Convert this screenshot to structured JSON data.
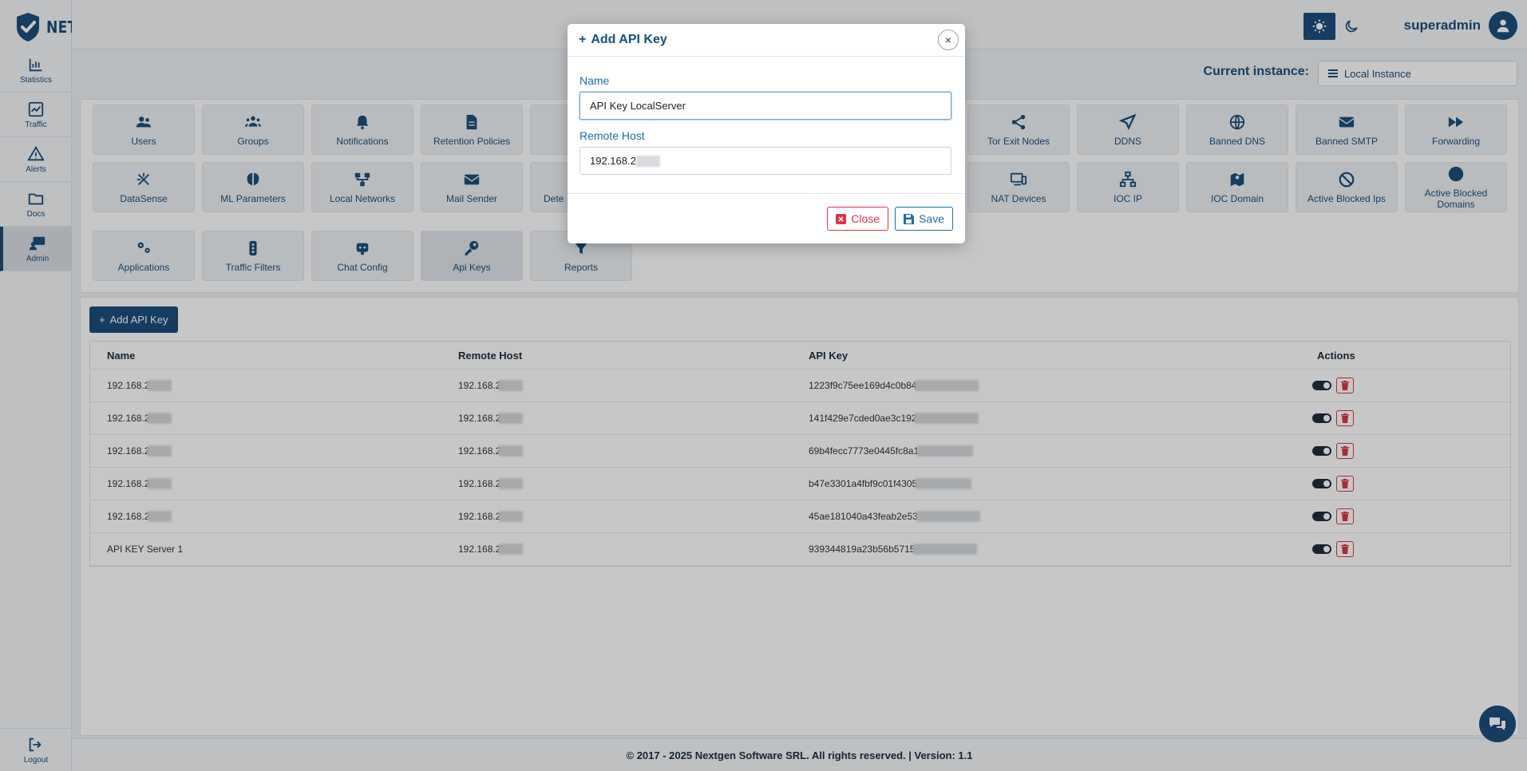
{
  "brand": {
    "name": "NETALERT"
  },
  "sidebar": {
    "items": [
      {
        "label": "Statistics",
        "icon": "bar-chart-icon"
      },
      {
        "label": "Traffic",
        "icon": "line-chart-icon"
      },
      {
        "label": "Alerts",
        "icon": "warning-icon"
      },
      {
        "label": "Docs",
        "icon": "folder-icon"
      },
      {
        "label": "Admin",
        "icon": "admin-icon"
      }
    ],
    "logout": "Logout"
  },
  "header": {
    "user": "superadmin"
  },
  "instance": {
    "label": "Current instance:",
    "value": "Local Instance"
  },
  "menu": {
    "tiles": [
      {
        "label": "Users",
        "icon": "users-icon"
      },
      {
        "label": "Groups",
        "icon": "groups-icon"
      },
      {
        "label": "Notifications",
        "icon": "bell-icon"
      },
      {
        "label": "Retention Policies",
        "icon": "file-icon"
      },
      {
        "label": "Tor Exit Nodes",
        "icon": "share-icon"
      },
      {
        "label": "DDNS",
        "icon": "send-icon"
      },
      {
        "label": "Banned DNS",
        "icon": "globe-icon"
      },
      {
        "label": "Banned SMTP",
        "icon": "envelope-icon"
      },
      {
        "label": "Forwarding",
        "icon": "forward-icon"
      },
      {
        "label": "DataSense",
        "icon": "datasense-icon"
      },
      {
        "label": "ML Parameters",
        "icon": "brain-icon"
      },
      {
        "label": "Local Networks",
        "icon": "network-icon"
      },
      {
        "label": "Mail Sender",
        "icon": "mail-icon"
      },
      {
        "label": "Dete",
        "icon": "detect-icon"
      },
      {
        "label": "NAT Devices",
        "icon": "devices-icon"
      },
      {
        "label": "IOC IP",
        "icon": "sitemap-icon"
      },
      {
        "label": "IOC Domain",
        "icon": "map-icon"
      },
      {
        "label": "Active Blocked Ips",
        "icon": "ban-icon"
      },
      {
        "label": "Active Blocked Domains",
        "icon": "circle-icon"
      },
      {
        "label": "Applications",
        "icon": "cogs-icon"
      },
      {
        "label": "Traffic Filters",
        "icon": "traffic-light-icon"
      },
      {
        "label": "Chat Config",
        "icon": "robot-icon"
      },
      {
        "label": "Api Keys",
        "icon": "key-icon"
      },
      {
        "label": "Reports",
        "icon": "filter-icon"
      }
    ]
  },
  "content": {
    "add_button": "Add API Key",
    "table": {
      "headers": [
        "Name",
        "Remote Host",
        "API Key",
        "Actions"
      ],
      "rows": [
        {
          "name": "192.168.2",
          "host": "192.168.2",
          "key": "1223f9c75ee169d4c0b84"
        },
        {
          "name": "192.168.2",
          "host": "192.168.2",
          "key": "141f429e7cded0ae3c192"
        },
        {
          "name": "192.168.2",
          "host": "192.168.2",
          "key": "69b4fecc7773e0445fc8a1"
        },
        {
          "name": "192.168.2",
          "host": "192.168.2",
          "key": "b47e3301a4fbf9c01f4305"
        },
        {
          "name": "192.168.2",
          "host": "192.168.2",
          "key": "45ae181040a43feab2e53"
        },
        {
          "name": "API KEY Server 1",
          "host": "192.168.2",
          "key": "939344819a23b56b5715"
        }
      ]
    }
  },
  "footer": {
    "text": "© 2017 - 2025 Nextgen Software SRL. All rights reserved. | Version: 1.1"
  },
  "modal": {
    "title": "Add API Key",
    "close_x": "×",
    "name_label": "Name",
    "name_value": "API Key LocalServer",
    "host_label": "Remote Host",
    "host_value": "192.168.2",
    "close_button": "Close",
    "save_button": "Save"
  },
  "colors": {
    "primary": "#1a4f7c",
    "danger": "#dc3545",
    "link": "#1a6fa8"
  }
}
